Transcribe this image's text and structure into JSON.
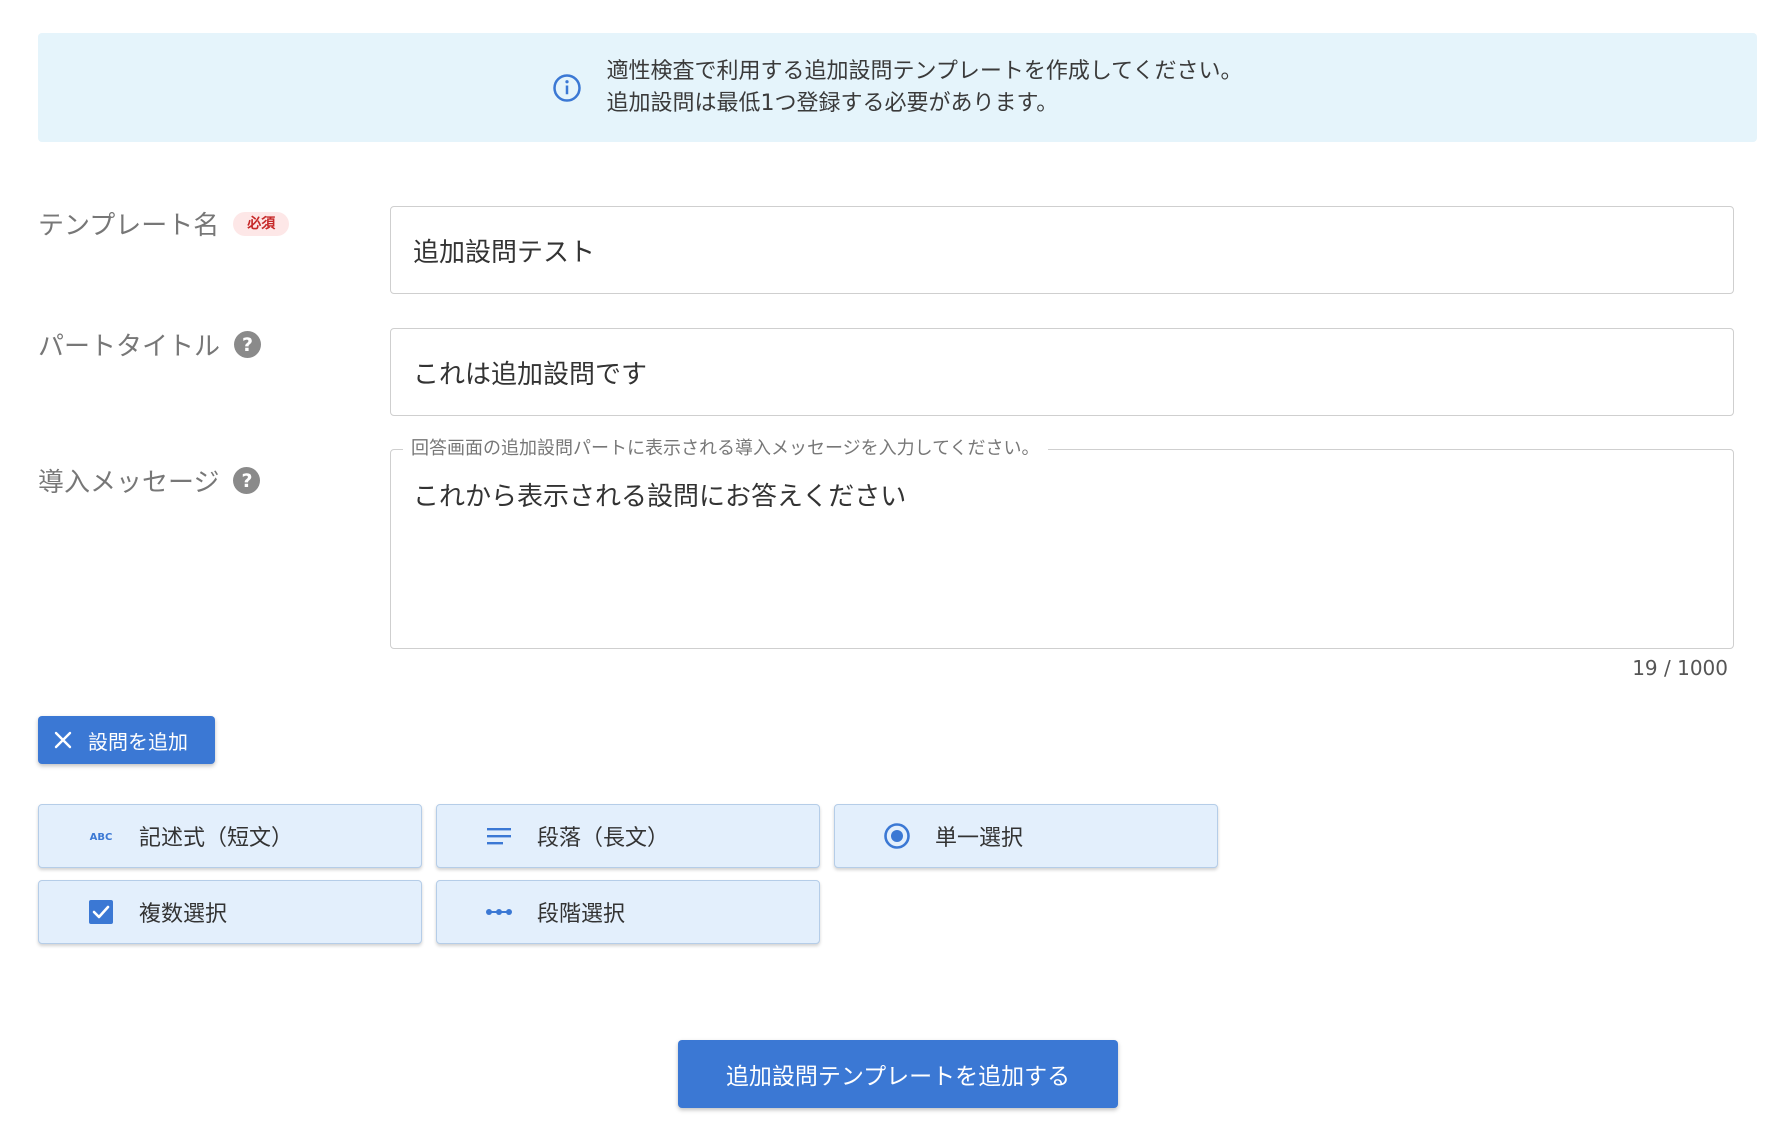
{
  "info_banner": {
    "line1": "適性検査で利用する追加設問テンプレートを作成してください。",
    "line2": "追加設問は最低1つ登録する必要があります。"
  },
  "form": {
    "template_name": {
      "label": "テンプレート名",
      "required_badge": "必須",
      "value": "追加設問テスト"
    },
    "part_title": {
      "label": "パートタイトル",
      "value": "これは追加設問です"
    },
    "intro_message": {
      "label": "導入メッセージ",
      "legend": "回答画面の追加設問パートに表示される導入メッセージを入力してください。",
      "value": "これから表示される設問にお答えください",
      "counter": "19 / 1000"
    }
  },
  "add_question_button": {
    "label": "設問を追加"
  },
  "question_types": [
    {
      "label": "記述式（短文）",
      "icon": "abc-icon"
    },
    {
      "label": "段落（長文）",
      "icon": "paragraph-lines-icon"
    },
    {
      "label": "単一選択",
      "icon": "radio-button-icon"
    },
    {
      "label": "複数選択",
      "icon": "checkbox-icon"
    },
    {
      "label": "段階選択",
      "icon": "linear-scale-icon"
    }
  ],
  "submit_button": {
    "label": "追加設問テンプレートを追加する"
  },
  "colors": {
    "primary": "#3b78d4",
    "banner_bg": "#e5f4fb",
    "type_button_bg": "#e3effc",
    "required_text": "#c62828"
  }
}
